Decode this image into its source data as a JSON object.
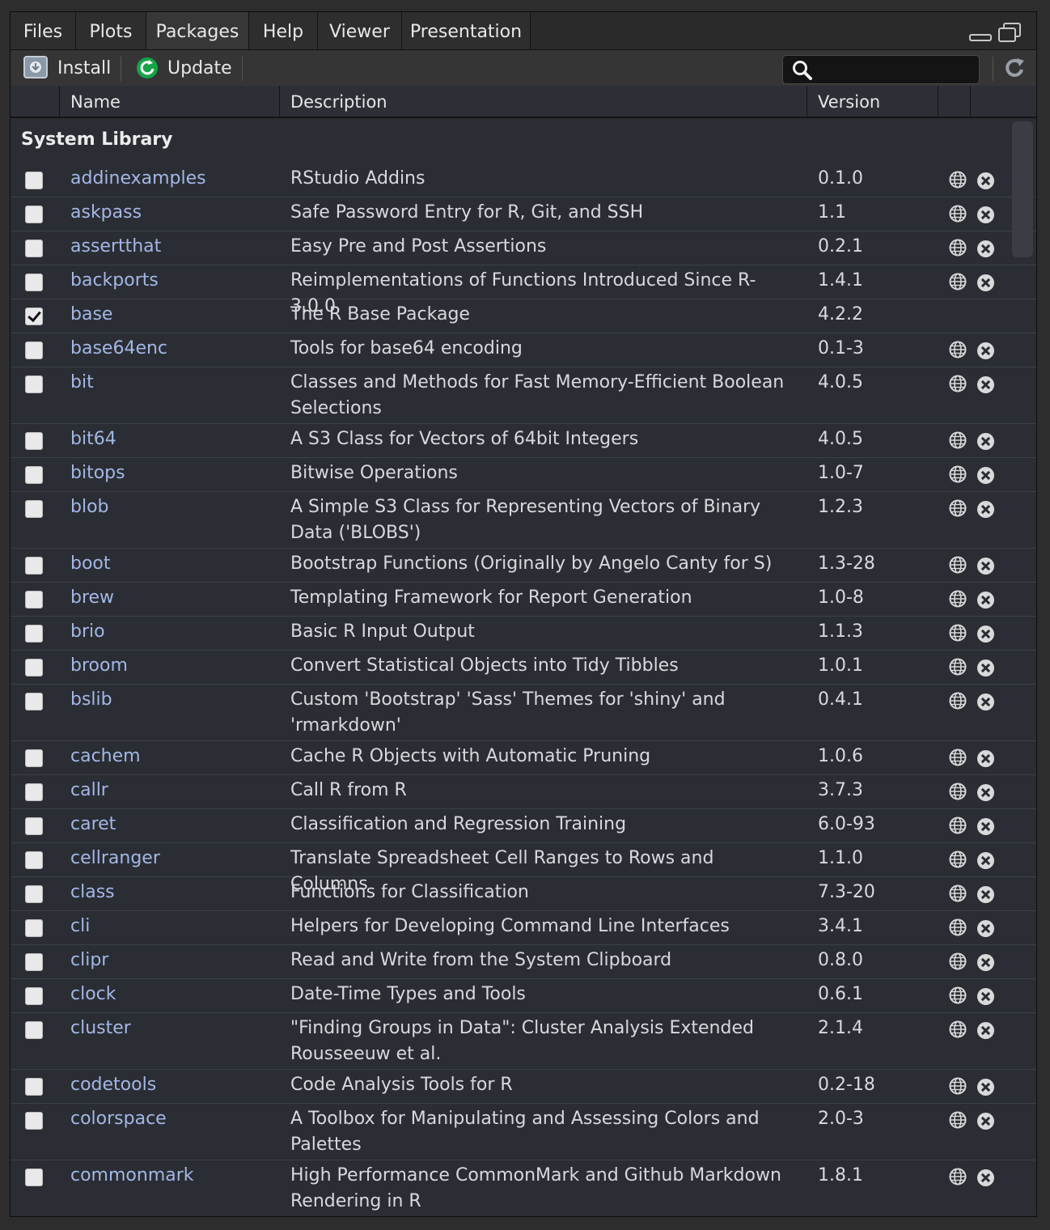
{
  "tabs": [
    "Files",
    "Plots",
    "Packages",
    "Help",
    "Viewer",
    "Presentation"
  ],
  "active_tab": "Packages",
  "toolbar": {
    "install_label": "Install",
    "update_label": "Update",
    "search_value": ""
  },
  "columns": {
    "name": "Name",
    "description": "Description",
    "version": "Version"
  },
  "section_title": "System Library",
  "packages": [
    {
      "name": "addinexamples",
      "description": "RStudio Addins",
      "version": "0.1.0",
      "checked": false,
      "lines": 1
    },
    {
      "name": "askpass",
      "description": "Safe Password Entry for R, Git, and SSH",
      "version": "1.1",
      "checked": false,
      "lines": 1
    },
    {
      "name": "assertthat",
      "description": "Easy Pre and Post Assertions",
      "version": "0.2.1",
      "checked": false,
      "lines": 1
    },
    {
      "name": "backports",
      "description": "Reimplementations of Functions Introduced Since R-3.0.0",
      "version": "1.4.1",
      "checked": false,
      "lines": 1
    },
    {
      "name": "base",
      "description": "The R Base Package",
      "version": "4.2.2",
      "checked": true,
      "lines": 1,
      "no_actions": true
    },
    {
      "name": "base64enc",
      "description": "Tools for base64 encoding",
      "version": "0.1-3",
      "checked": false,
      "lines": 1
    },
    {
      "name": "bit",
      "description": "Classes and Methods for Fast Memory-Efficient Boolean Selections",
      "version": "4.0.5",
      "checked": false,
      "lines": 2
    },
    {
      "name": "bit64",
      "description": "A S3 Class for Vectors of 64bit Integers",
      "version": "4.0.5",
      "checked": false,
      "lines": 1
    },
    {
      "name": "bitops",
      "description": "Bitwise Operations",
      "version": "1.0-7",
      "checked": false,
      "lines": 1
    },
    {
      "name": "blob",
      "description": "A Simple S3 Class for Representing Vectors of Binary Data ('BLOBS')",
      "version": "1.2.3",
      "checked": false,
      "lines": 2
    },
    {
      "name": "boot",
      "description": "Bootstrap Functions (Originally by Angelo Canty for S)",
      "version": "1.3-28",
      "checked": false,
      "lines": 1
    },
    {
      "name": "brew",
      "description": "Templating Framework for Report Generation",
      "version": "1.0-8",
      "checked": false,
      "lines": 1
    },
    {
      "name": "brio",
      "description": "Basic R Input Output",
      "version": "1.1.3",
      "checked": false,
      "lines": 1
    },
    {
      "name": "broom",
      "description": "Convert Statistical Objects into Tidy Tibbles",
      "version": "1.0.1",
      "checked": false,
      "lines": 1
    },
    {
      "name": "bslib",
      "description": "Custom 'Bootstrap' 'Sass' Themes for 'shiny' and 'rmarkdown'",
      "version": "0.4.1",
      "checked": false,
      "lines": 2
    },
    {
      "name": "cachem",
      "description": "Cache R Objects with Automatic Pruning",
      "version": "1.0.6",
      "checked": false,
      "lines": 1
    },
    {
      "name": "callr",
      "description": "Call R from R",
      "version": "3.7.3",
      "checked": false,
      "lines": 1
    },
    {
      "name": "caret",
      "description": "Classification and Regression Training",
      "version": "6.0-93",
      "checked": false,
      "lines": 1
    },
    {
      "name": "cellranger",
      "description": "Translate Spreadsheet Cell Ranges to Rows and Columns",
      "version": "1.1.0",
      "checked": false,
      "lines": 1
    },
    {
      "name": "class",
      "description": "Functions for Classification",
      "version": "7.3-20",
      "checked": false,
      "lines": 1
    },
    {
      "name": "cli",
      "description": "Helpers for Developing Command Line Interfaces",
      "version": "3.4.1",
      "checked": false,
      "lines": 1
    },
    {
      "name": "clipr",
      "description": "Read and Write from the System Clipboard",
      "version": "0.8.0",
      "checked": false,
      "lines": 1
    },
    {
      "name": "clock",
      "description": "Date-Time Types and Tools",
      "version": "0.6.1",
      "checked": false,
      "lines": 1
    },
    {
      "name": "cluster",
      "description": "\"Finding Groups in Data\": Cluster Analysis Extended Rousseeuw et al.",
      "version": "2.1.4",
      "checked": false,
      "lines": 2
    },
    {
      "name": "codetools",
      "description": "Code Analysis Tools for R",
      "version": "0.2-18",
      "checked": false,
      "lines": 1
    },
    {
      "name": "colorspace",
      "description": "A Toolbox for Manipulating and Assessing Colors and Palettes",
      "version": "2.0-3",
      "checked": false,
      "lines": 2
    },
    {
      "name": "commonmark",
      "description": "High Performance CommonMark and Github Markdown Rendering in R",
      "version": "1.8.1",
      "checked": false,
      "lines": 2
    }
  ]
}
